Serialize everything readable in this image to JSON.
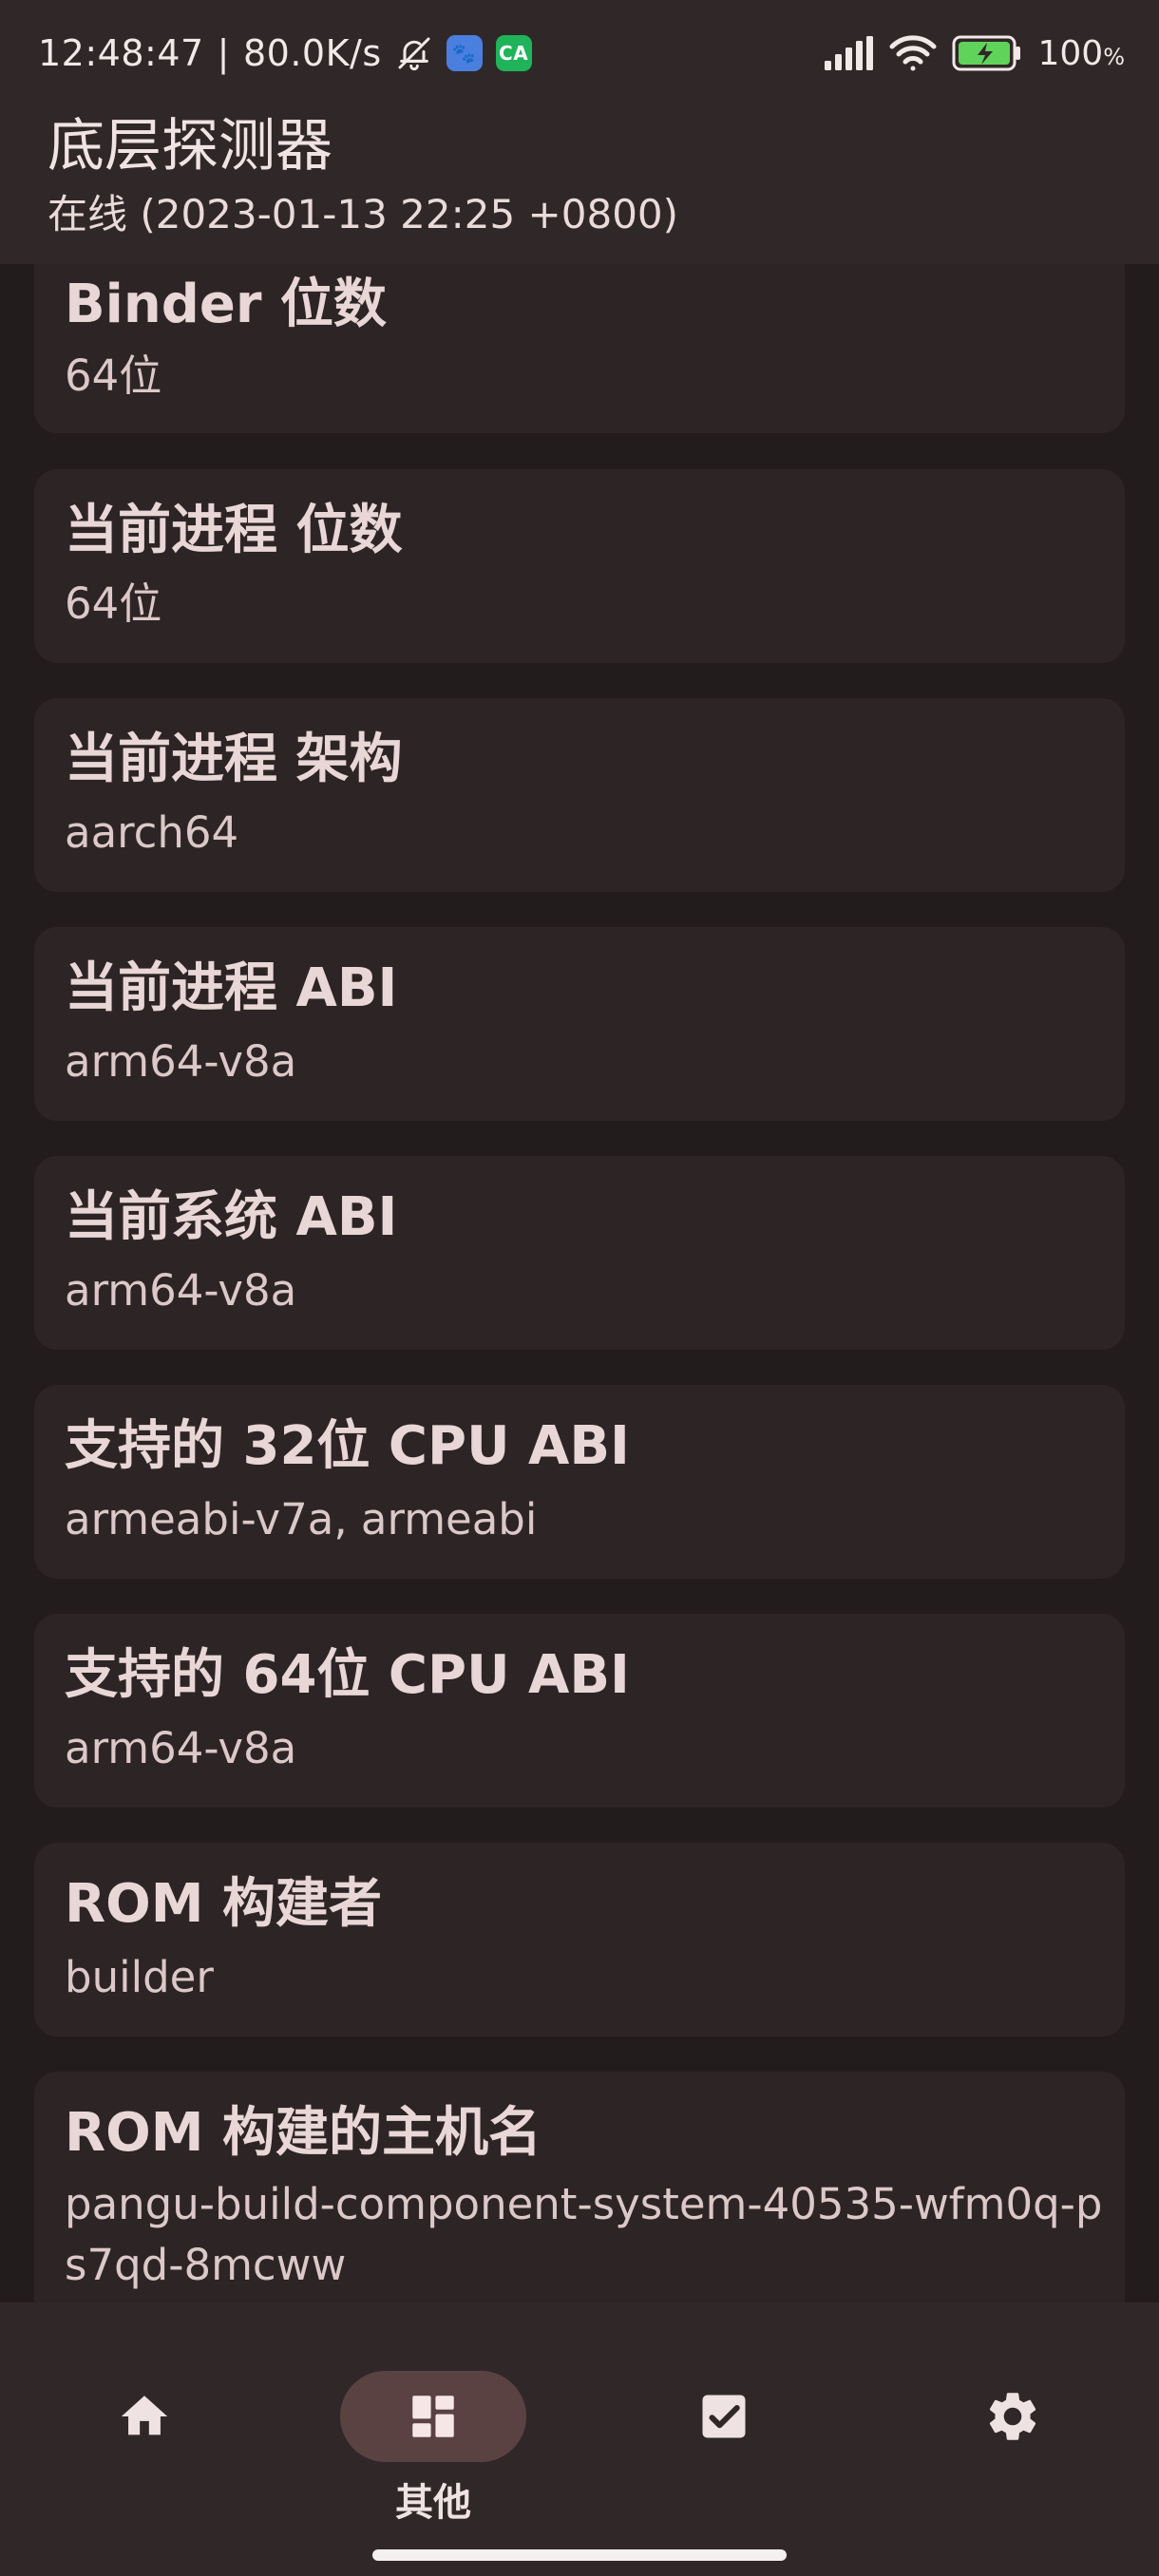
{
  "status_bar": {
    "time": "12:48:47",
    "separator": "|",
    "net_speed": "80.0K/s",
    "notif_app_1": "🐾",
    "notif_app_2": "CA",
    "battery_text": "100",
    "battery_sign": "%",
    "battery_level": 1.0
  },
  "app_bar": {
    "title": "底层探测器",
    "subtitle": "在线 (2023-01-13 22:25 +0800)"
  },
  "cards": [
    {
      "title": "Binder 位数",
      "value": "64位"
    },
    {
      "title": "当前进程 位数",
      "value": "64位"
    },
    {
      "title": "当前进程 架构",
      "value": "aarch64"
    },
    {
      "title": "当前进程 ABI",
      "value": "arm64-v8a"
    },
    {
      "title": "当前系统 ABI",
      "value": "arm64-v8a"
    },
    {
      "title": "支持的 32位 CPU ABI",
      "value": "armeabi-v7a, armeabi"
    },
    {
      "title": "支持的 64位 CPU ABI",
      "value": "arm64-v8a"
    },
    {
      "title": "ROM 构建者",
      "value": "builder"
    },
    {
      "title": "ROM 构建的主机名",
      "value": "pangu-build-component-system-40535-wfm0q-ps7qd-8mcww"
    }
  ],
  "bottom_nav": {
    "items": [
      {
        "icon": "home-icon",
        "label": ""
      },
      {
        "icon": "dashboard-icon",
        "label": "其他",
        "active": true
      },
      {
        "icon": "checkbox-icon",
        "label": ""
      },
      {
        "icon": "gear-icon",
        "label": ""
      }
    ]
  },
  "colors": {
    "background": "#221c1c",
    "surface": "#2d2525",
    "bar": "#302828",
    "active_pill": "#5b4242",
    "battery_green": "#5fd35a"
  }
}
